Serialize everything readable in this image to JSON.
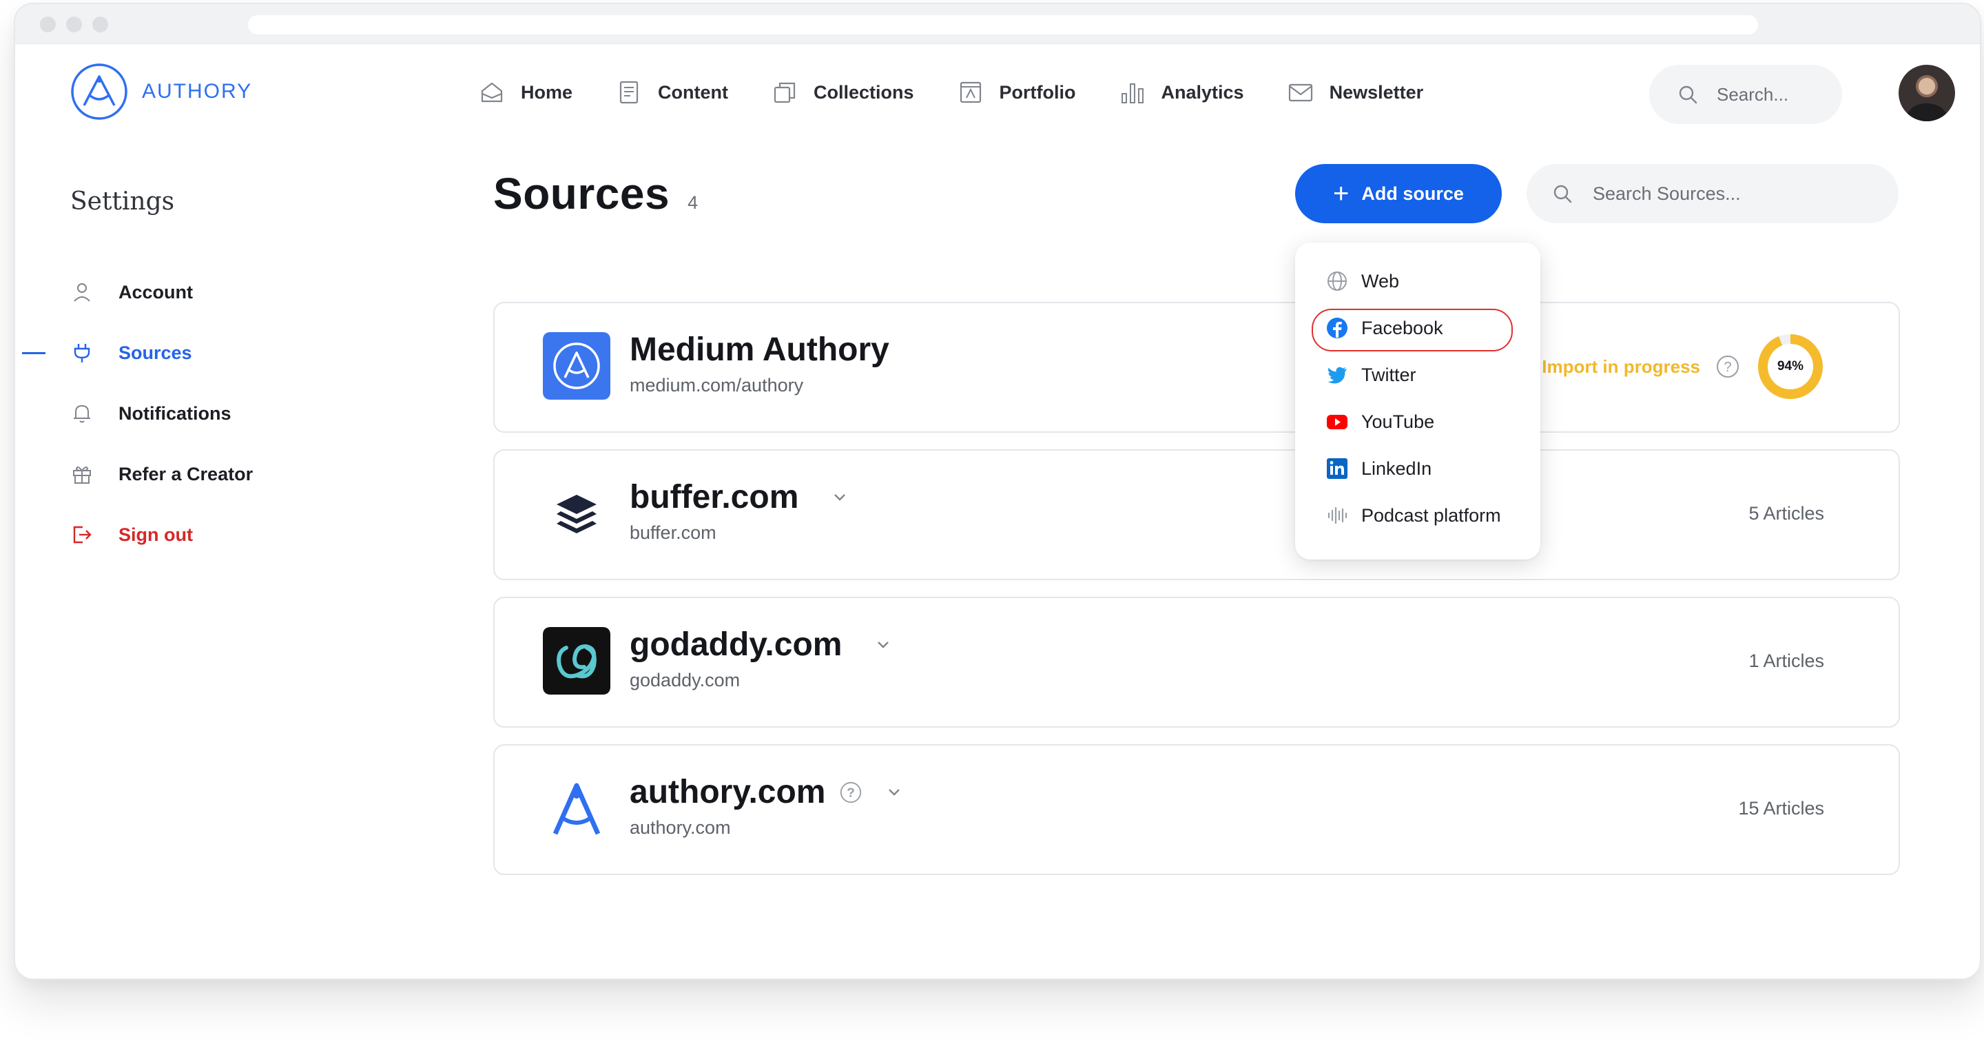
{
  "brand": {
    "name": "AUTHORY",
    "accent": "#2563eb"
  },
  "nav": {
    "items": [
      {
        "label": "Home",
        "icon": "home-icon"
      },
      {
        "label": "Content",
        "icon": "content-icon"
      },
      {
        "label": "Collections",
        "icon": "collections-icon"
      },
      {
        "label": "Portfolio",
        "icon": "portfolio-icon"
      },
      {
        "label": "Analytics",
        "icon": "analytics-icon"
      },
      {
        "label": "Newsletter",
        "icon": "newsletter-icon"
      }
    ],
    "search_placeholder": "Search..."
  },
  "sidebar": {
    "title": "Settings",
    "items": [
      {
        "label": "Account",
        "icon": "user-icon"
      },
      {
        "label": "Sources",
        "icon": "plug-icon",
        "active": true
      },
      {
        "label": "Notifications",
        "icon": "bell-icon"
      },
      {
        "label": "Refer a Creator",
        "icon": "gift-icon"
      },
      {
        "label": "Sign out",
        "icon": "sign-out-icon",
        "danger": true
      }
    ]
  },
  "main": {
    "title": "Sources",
    "count": "4",
    "add_button_label": "Add source",
    "search_placeholder": "Search Sources..."
  },
  "sources": [
    {
      "name": "Medium Authory",
      "url": "medium.com/authory",
      "status": "Import in progress",
      "progress": "94%",
      "progress_value": 0.94,
      "status_color": "#f1b82b"
    },
    {
      "name": "buffer.com",
      "url": "buffer.com",
      "articles": "5 Articles"
    },
    {
      "name": "godaddy.com",
      "url": "godaddy.com",
      "articles": "1 Articles"
    },
    {
      "name": "authory.com",
      "url": "authory.com",
      "articles": "15 Articles"
    }
  ],
  "dropdown": {
    "items": [
      {
        "label": "Web",
        "icon": "globe-icon"
      },
      {
        "label": "Facebook",
        "icon": "facebook-icon",
        "highlighted": true
      },
      {
        "label": "Twitter",
        "icon": "twitter-icon"
      },
      {
        "label": "YouTube",
        "icon": "youtube-icon"
      },
      {
        "label": "LinkedIn",
        "icon": "linkedin-icon"
      },
      {
        "label": "Podcast platform",
        "icon": "podcast-icon"
      }
    ]
  }
}
